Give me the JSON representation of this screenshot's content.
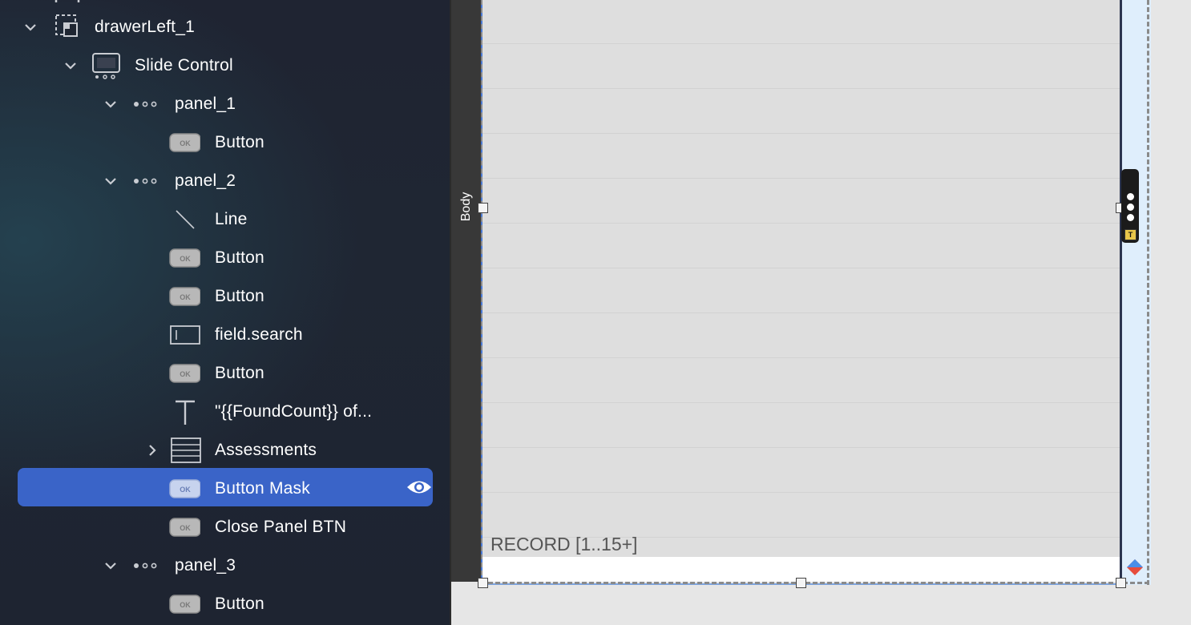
{
  "tree": {
    "items": [
      {
        "label": "drawerLeft_1",
        "icon": "drawer-icon",
        "expanded": true
      },
      {
        "label": "Slide Control",
        "icon": "slide-control-icon",
        "expanded": true
      },
      {
        "label": "panel_1",
        "icon": "panel-icon",
        "expanded": true
      },
      {
        "label": "Button",
        "icon": "button-icon"
      },
      {
        "label": "panel_2",
        "icon": "panel-icon",
        "expanded": true
      },
      {
        "label": "Line",
        "icon": "line-icon"
      },
      {
        "label": "Button",
        "icon": "button-icon"
      },
      {
        "label": "Button",
        "icon": "button-icon"
      },
      {
        "label": "field.search",
        "icon": "field-icon"
      },
      {
        "label": "Button",
        "icon": "button-icon"
      },
      {
        "label": "\"{{FoundCount}} of...",
        "icon": "text-icon"
      },
      {
        "label": "Assessments",
        "icon": "portal-icon",
        "expanded": false
      },
      {
        "label": "Button Mask",
        "icon": "button-icon",
        "selected": true,
        "visible_toggle": "eye-icon"
      },
      {
        "label": "Close Panel BTN",
        "icon": "button-icon"
      },
      {
        "label": "panel_3",
        "icon": "panel-icon",
        "expanded": true
      },
      {
        "label": "Button",
        "icon": "button-icon"
      }
    ],
    "button_icon_text": "OK",
    "colors": {
      "selected": "#3a64c8",
      "text": "#ffffff"
    }
  },
  "canvas": {
    "part_label": "Body",
    "footer_text": "RECORD [1..15+]",
    "badge_letter": "T"
  }
}
